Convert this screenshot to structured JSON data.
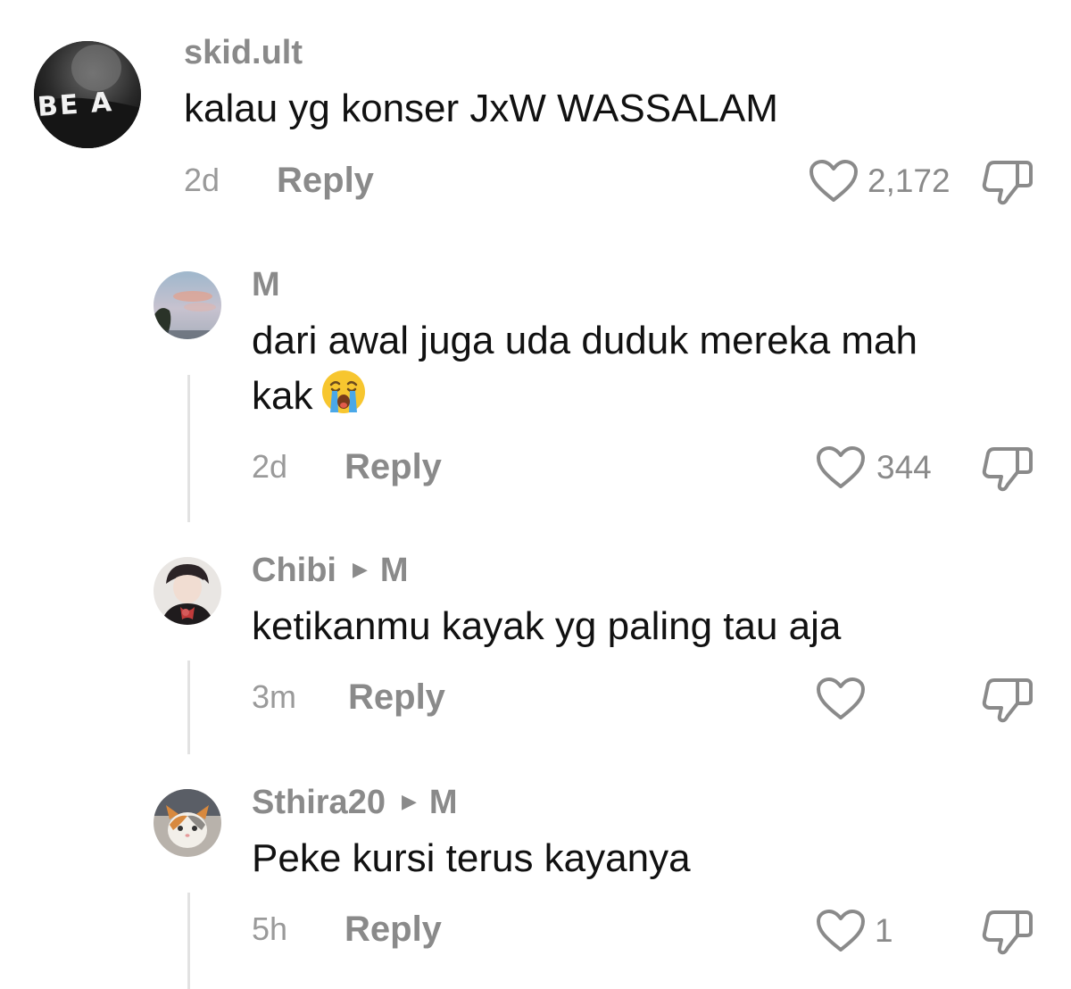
{
  "comments": [
    {
      "username": "skid.ult",
      "avatar_text": "BE A",
      "text": "kalau yg konser JxW WASSALAM",
      "time": "2d",
      "reply_label": "Reply",
      "likes": "2,172"
    },
    {
      "username": "M",
      "text": "dari awal juga uda duduk mereka mah",
      "text_line2": "kak",
      "emoji": "loudly-crying-face",
      "time": "2d",
      "reply_label": "Reply",
      "likes": "344"
    },
    {
      "username": "Chibi",
      "reply_to": "M",
      "text": "ketikanmu kayak yg paling tau aja",
      "time": "3m",
      "reply_label": "Reply",
      "likes": ""
    },
    {
      "username": "Sthira20",
      "reply_to": "M",
      "text": "Peke kursi terus kayanya",
      "time": "5h",
      "reply_label": "Reply",
      "likes": "1"
    }
  ],
  "colors": {
    "username": "#8a8a8a",
    "text": "#111111",
    "meta": "#9a9a9a",
    "thread_line": "#e2e2e2"
  }
}
